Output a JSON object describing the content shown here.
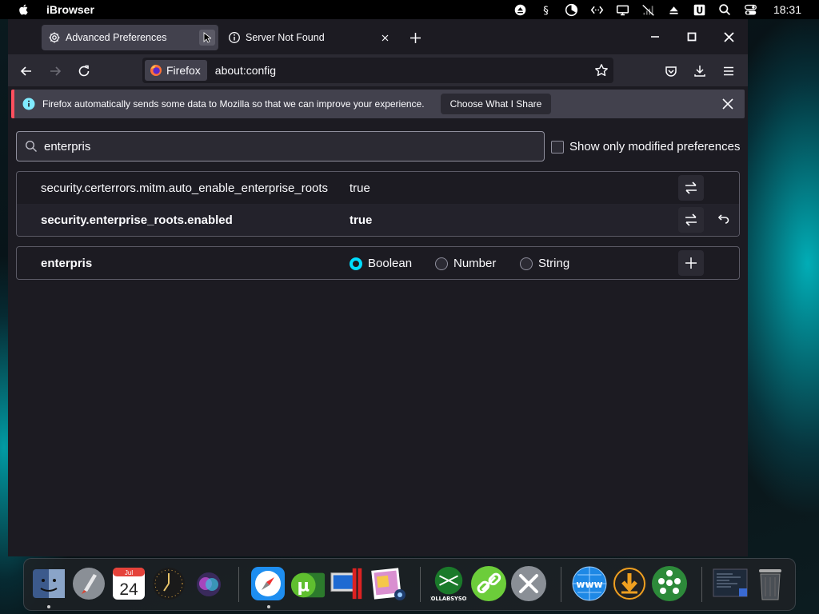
{
  "menubar": {
    "app_name": "iBrowser",
    "clock": "18:31",
    "status_icons": [
      "eject-icon",
      "dollar-icon",
      "pie-chart-icon",
      "code-icon",
      "monitor-icon",
      "no-signal-icon",
      "upload-icon",
      "u-badge-icon",
      "search-icon",
      "control-center-icon"
    ]
  },
  "tabs": [
    {
      "title": "Advanced Preferences",
      "icon": "gear-icon",
      "active": true
    },
    {
      "title": "Server Not Found",
      "icon": "info-icon",
      "active": false
    }
  ],
  "navbar": {
    "identity_label": "Firefox",
    "url": "about:config"
  },
  "notification": {
    "message": "Firefox automatically sends some data to Mozilla so that we can improve your experience.",
    "button_label": "Choose What I Share"
  },
  "config": {
    "search_value": "enterpris",
    "modified_only_label": "Show only modified preferences",
    "modified_only_checked": false,
    "preferences": [
      {
        "name": "security.certerrors.mitm.auto_enable_enterprise_roots",
        "value": "true",
        "modified": false
      },
      {
        "name": "security.enterprise_roots.enabled",
        "value": "true",
        "modified": true
      }
    ],
    "new_pref": {
      "name": "enterpris",
      "types": [
        "Boolean",
        "Number",
        "String"
      ],
      "selected_type": "Boolean"
    }
  },
  "dock": {
    "items": [
      "finder-icon",
      "launchpad-icon",
      "calendar-icon",
      "clock-icon",
      "siri-icon",
      "safari-icon",
      "utorrent-icon",
      "parallels-icon",
      "photo-preview-icon",
      "collabsysos-icon",
      "link-icon",
      "tools-icon",
      "www-icon",
      "download-icon",
      "network-icon",
      "screenshot-icon",
      "trash-icon"
    ],
    "calendar_month": "Jul",
    "calendar_day": "24",
    "collab_label": "COLLABSYSOS"
  },
  "colors": {
    "accent": "#00ddff",
    "notification_border": "#ff4f5e",
    "window_bg": "#1c1b22",
    "toolbar_bg": "#2b2a33"
  }
}
